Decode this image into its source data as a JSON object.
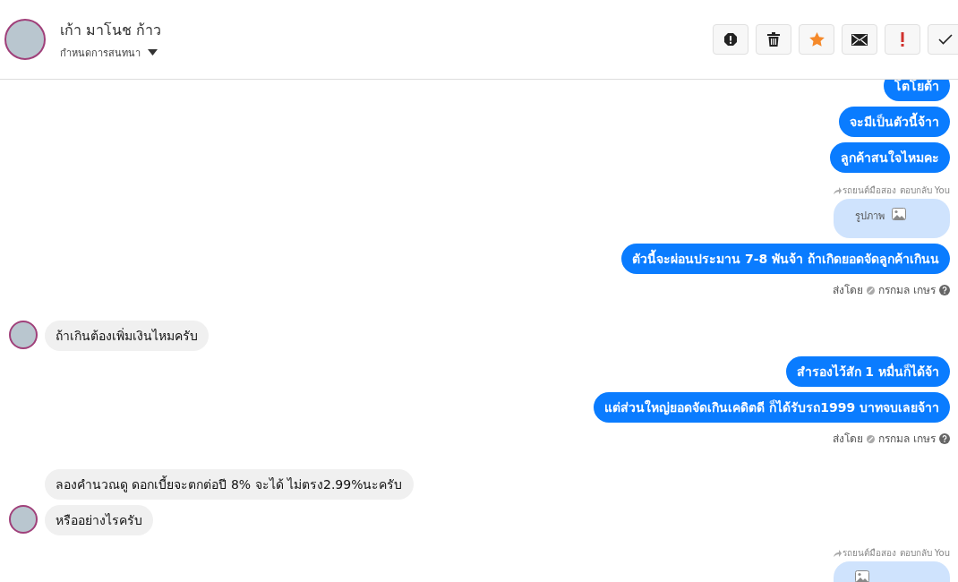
{
  "header": {
    "name": "เก้า มาโนช ก้าว",
    "subtitle": "กำหนดการสนทนา"
  },
  "toolbar": [
    {
      "kind": "alert"
    },
    {
      "kind": "trash"
    },
    {
      "kind": "star"
    },
    {
      "kind": "mail"
    },
    {
      "kind": "exclaim"
    },
    {
      "kind": "check"
    }
  ],
  "messages": [
    {
      "kind": "out",
      "text": "โตโยต้า"
    },
    {
      "kind": "out",
      "text": "จะมีเป็นตัวนี้จ้าา"
    },
    {
      "kind": "out",
      "text": "ลูกค้าสนใจไหมคะ"
    },
    {
      "kind": "reply_label",
      "text": "รถยนต์มือสอง ตอบกลับ You"
    },
    {
      "kind": "image",
      "text": "รูปภาพ"
    },
    {
      "kind": "out",
      "text": "ตัวนี้จะผ่อนประมาน 7-8 พันจ้า ถ้าเกิดยอดจัดลูกค้าเกินน"
    },
    {
      "kind": "sent_by",
      "label": "ส่งโดย",
      "name": "กรกมล เกษร"
    },
    {
      "kind": "in",
      "text": "ถ้าเกินต้องเพิ่มเงินไหมครับ",
      "avatar": true
    },
    {
      "kind": "out",
      "text": "สำรองไว้สัก 1 หมื่นก็ได้จ้า"
    },
    {
      "kind": "out",
      "text": "แต่ส่วนใหญ่ยอดจัดเกินเคดิตดี ก็ได้รับรถ1999 บาทจบเลยจ้าา"
    },
    {
      "kind": "sent_by",
      "label": "ส่งโดย",
      "name": "กรกมล เกษร"
    },
    {
      "kind": "in",
      "text": "ลองคำนวณดู ดอกเบี้ยจะตกต่อปี 8% จะได้  ไม่ตรง2.99%นะครับ",
      "avatar": false
    },
    {
      "kind": "in",
      "text": "หรืออย่างไรครับ",
      "avatar": true
    },
    {
      "kind": "reply_label",
      "text": "รถยนต์มือสอง ตอบกลับ You"
    },
    {
      "kind": "image"
    }
  ]
}
